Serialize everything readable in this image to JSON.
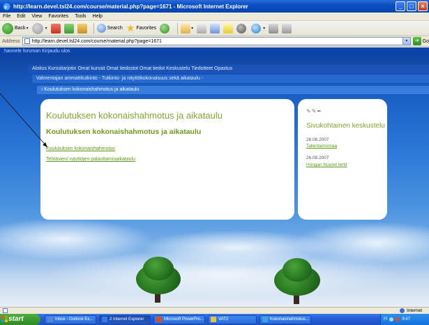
{
  "window": {
    "title": "http://learn.devel.tsl24.com/course/material.php?page=1671 - Microsoft Internet Explorer",
    "controls": [
      "_",
      "□",
      "×"
    ]
  },
  "menubar": {
    "items": [
      "File",
      "Edit",
      "View",
      "Favorites",
      "Tools",
      "Help"
    ]
  },
  "toolbar": {
    "back_label": "Back",
    "search_label": "Search",
    "favorites_label": "Favorites"
  },
  "addressbar": {
    "label": "Address",
    "url": "http://learn.devel.tsl24.com/course/material.php?page=1671",
    "go_label": "Go"
  },
  "site": {
    "user_line": "hannele forsman Kirjaudu ulos",
    "nav_main": "Aloitus Kurssitarjotin Omat kurssit Omat tiedostot Omat tiedot Keskustelu Tiedotteet Opastus",
    "nav_sub": "Valmentajan ammattitutkinto -  Tutkinto- ja näyttökokonaisuus sekä aikataulu -",
    "nav_crumb": "› Koulutuksen kokonaishahmotus ja aikataulu"
  },
  "main": {
    "title": "Koulutuksen kokonaishahmotus ja aikataulu",
    "heading": "Koulutuksen kokonaishahmotus ja aikataulu",
    "links": [
      "Koulutuksen kokonaishahmotus",
      "Tehtävien/ näyttöjen palauttamisaikataulu"
    ]
  },
  "sidebar": {
    "title": "Sivukohtainen keskustelu",
    "entries": [
      {
        "date": "26.08.2007",
        "link": "Tallentamomaa"
      },
      {
        "date": "26.08.2007",
        "link": "Hongan Nuoret tertit"
      }
    ]
  },
  "statusbar": {
    "zone": "Internet"
  },
  "taskbar": {
    "start_label": "start",
    "items": [
      {
        "label": "Inbox - Outlook Ex...",
        "color": "#5a86d8"
      },
      {
        "label": "2 Internet Explorer",
        "color": "#2f7ee8"
      },
      {
        "label": "Microsoft PowerPoi...",
        "color": "#d8501e"
      },
      {
        "label": "VAT2",
        "color": "#e5c04a"
      },
      {
        "label": "Kokonaishahmotus...",
        "color": "#3aa5d8"
      }
    ],
    "tray_text": "FI",
    "clock": "9:47"
  },
  "colors": {
    "accent_green": "#7ea82e",
    "xp_blue": "#245edb"
  }
}
